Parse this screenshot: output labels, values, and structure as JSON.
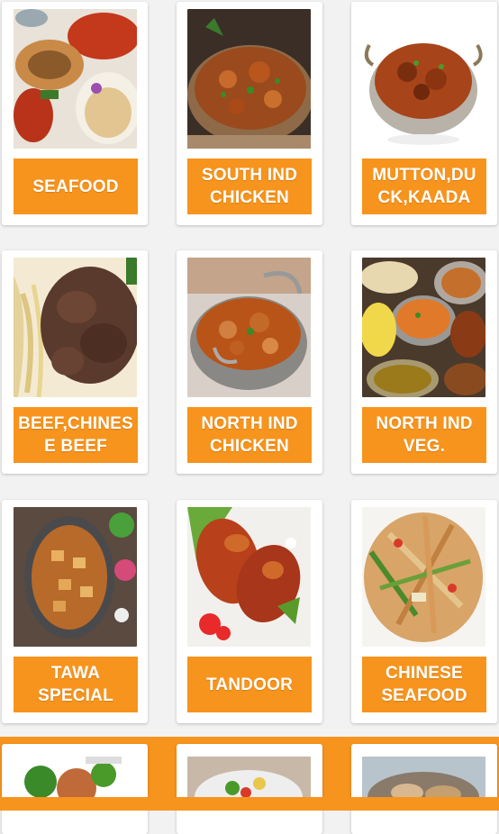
{
  "categories": [
    {
      "label": "SEAFOOD",
      "image": "seafood-platter"
    },
    {
      "label": "SOUTH IND\nCHICKEN",
      "image": "chicken-curry-pot"
    },
    {
      "label": "MUTTON,DU\nCK,KAADA",
      "image": "mutton-curry-bowl"
    },
    {
      "label": "BEEF,CHINES\nE BEEF",
      "image": "beef-noodles"
    },
    {
      "label": "NORTH IND\nCHICKEN",
      "image": "chicken-kadai"
    },
    {
      "label": "NORTH IND\nVEG.",
      "image": "veg-thali"
    },
    {
      "label": "TAWA\nSPECIAL",
      "image": "tawa-paneer"
    },
    {
      "label": "TANDOOR",
      "image": "tandoori-chicken"
    },
    {
      "label": "CHINESE\nSEAFOOD",
      "image": "chinese-stir-fry"
    }
  ],
  "partial_row": [
    {
      "image": "broccoli-dish"
    },
    {
      "image": "salad-bowl"
    },
    {
      "image": "seafood-plate"
    }
  ],
  "colors": {
    "accent": "#f7941d",
    "background": "#f2f2f2",
    "card": "#ffffff"
  }
}
